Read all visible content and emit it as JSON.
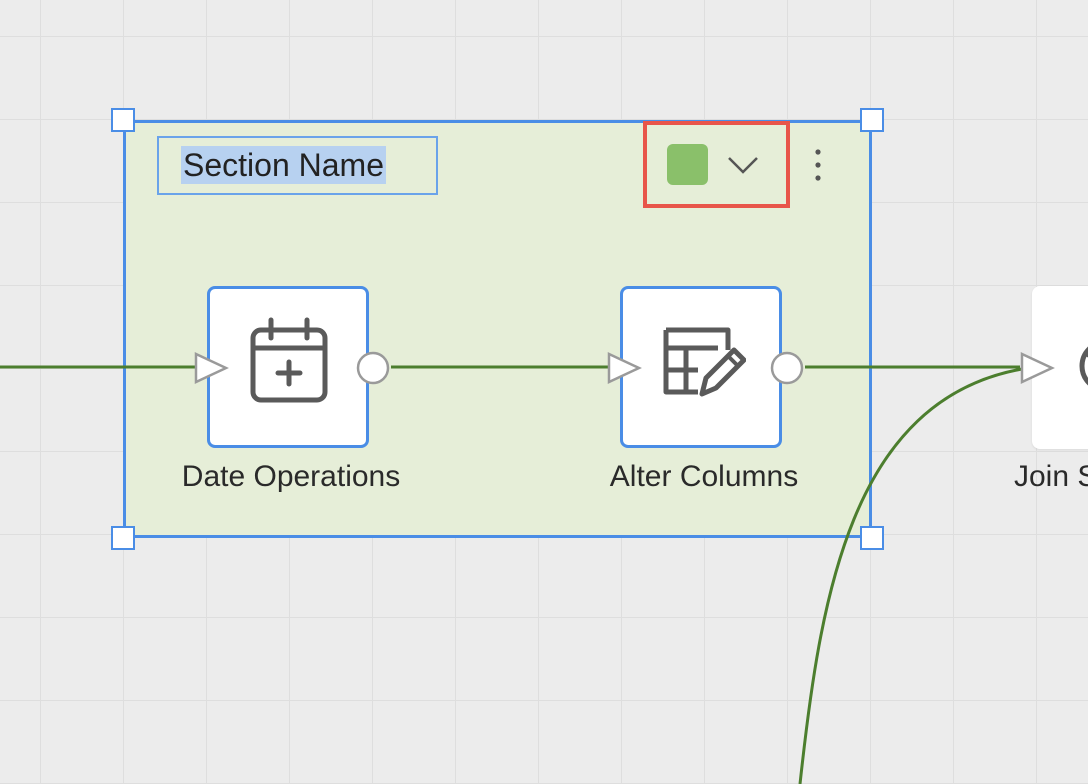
{
  "canvas": {
    "section": {
      "name": "Section Name",
      "color": "#8ac06a",
      "color_picker_icon": "chevron-down-icon",
      "menu_icon": "more-vertical-icon"
    },
    "nodes": [
      {
        "label": "Date Operations",
        "icon": "calendar-plus-icon"
      },
      {
        "label": "Alter Columns",
        "icon": "table-edit-icon"
      },
      {
        "label": "Join S",
        "icon": "join-icon"
      }
    ],
    "colors": {
      "edge": "#4c7e2e",
      "selection": "#4a8de6",
      "highlight": "#e8554a",
      "section_fill": "#e6eed8"
    }
  }
}
